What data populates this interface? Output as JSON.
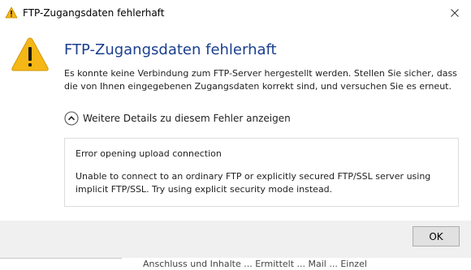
{
  "window": {
    "title": "FTP-Zugangsdaten fehlerhaft",
    "close_icon": "close-icon"
  },
  "dialog": {
    "icon": "warning-icon",
    "heading": "FTP-Zugangsdaten fehlerhaft",
    "message": "Es konnte keine Verbindung zum FTP-Server hergestellt werden. Stellen Sie sicher, dass die von Ihnen eingegebenen Zugangsdaten korrekt sind, und versuchen Sie es erneut.",
    "expander": {
      "icon": "chevron-up-circle-icon",
      "label": "Weitere Details zu diesem Fehler anzeigen"
    },
    "details": {
      "title": "Error opening upload connection",
      "body": "Unable to connect to an ordinary FTP or explicitly secured FTP/SSL server using implicit FTP/SSL. Try using explicit security mode instead."
    },
    "ok_label": "OK"
  },
  "background_window": {
    "partial_text": "Anschluss und Inhalte ... Ermittelt ... Mail ... Einzel"
  },
  "colors": {
    "heading": "#1a3f8e",
    "warning_fill": "#f5b716",
    "button_face": "#e1e1e1",
    "dialog_bg": "#f0f0f0"
  }
}
